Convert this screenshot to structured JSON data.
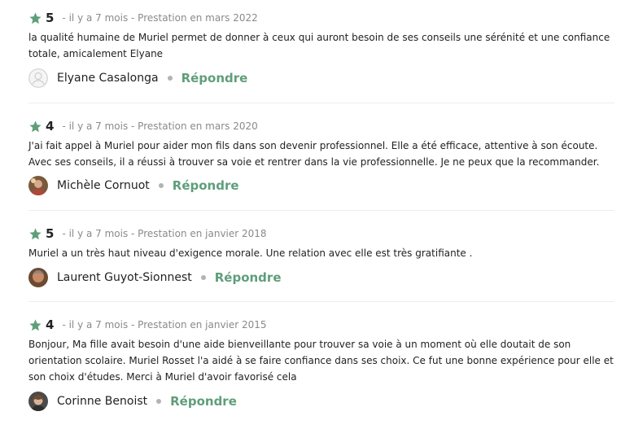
{
  "colors": {
    "star": "#5f9e7a",
    "reply": "#5f9e7a",
    "meta": "#8a8a8a"
  },
  "reviews": [
    {
      "rating": "5",
      "meta": "- il y a 7 mois - Prestation en mars 2022",
      "text": "la qualité humaine de Muriel permet de donner à ceux qui auront besoin de ses conseils une sérénité et une confiance totale, amicalement Elyane",
      "author": "Elyane Casalonga",
      "avatar_icon": "default-user-icon",
      "reply_label": "Répondre"
    },
    {
      "rating": "4",
      "meta": "- il y a 7 mois - Prestation en mars 2020",
      "text": "J'ai fait appel à Muriel pour aider mon fils dans son devenir professionnel. Elle a été efficace, attentive à son écoute. Avec ses conseils, il a réussi à trouver sa voie et rentrer dans la vie professionnelle. Je ne peux que la recommander.",
      "author": "Michèle Cornuot",
      "avatar_icon": "photo-avatar",
      "reply_label": "Répondre"
    },
    {
      "rating": "5",
      "meta": "- il y a 7 mois - Prestation en janvier 2018",
      "text": "Muriel a un très haut niveau d'exigence morale. Une relation avec elle est très gratifiante .",
      "author": "Laurent Guyot-Sionnest",
      "avatar_icon": "photo-avatar",
      "reply_label": "Répondre"
    },
    {
      "rating": "4",
      "meta": "- il y a 7 mois - Prestation en janvier 2015",
      "text": "Bonjour, Ma fille avait besoin d'une aide bienveillante pour trouver sa voie à un moment où elle doutait de son orientation scolaire. Muriel Rosset l'a aidé à se faire confiance dans ses choix. Ce fut une bonne expérience pour elle et son choix d'études. Merci à Muriel d'avoir favorisé cela",
      "author": "Corinne Benoist",
      "avatar_icon": "photo-avatar",
      "reply_label": "Répondre"
    }
  ]
}
